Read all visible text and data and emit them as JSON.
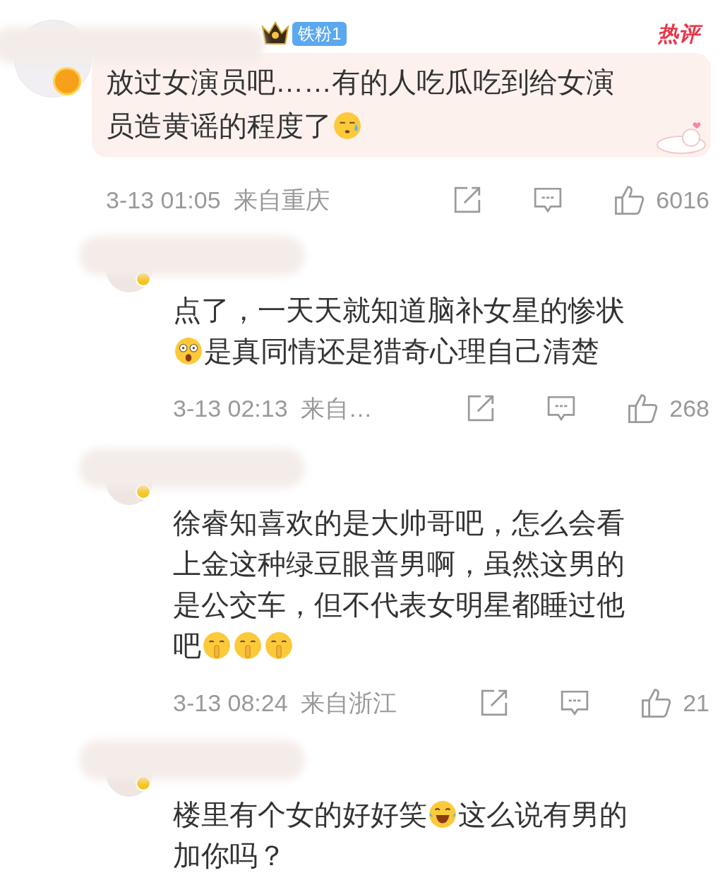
{
  "comments": [
    {
      "kind": "top",
      "hot_label": "热评",
      "fan_badge": "铁粉1",
      "lines": [
        [
          {
            "kind": "text",
            "text": "放过女演员吧……有的人吃瓜吃到给女演"
          }
        ],
        [
          {
            "kind": "text",
            "text": "员造黄谣的程度了"
          },
          {
            "kind": "sweat"
          }
        ]
      ],
      "time": "3-13 01:05",
      "location": "来自重庆",
      "likes": "6016"
    },
    {
      "kind": "reply",
      "lines": [
        [
          {
            "kind": "text",
            "text": "点了，一天天就知道脑补女星的惨状"
          }
        ],
        [
          {
            "kind": "shocked"
          },
          {
            "kind": "text",
            "text": "是真同情还是猎奇心理自己清楚"
          }
        ]
      ],
      "time": "3-13 02:13",
      "location": "来自…",
      "likes": "268"
    },
    {
      "kind": "reply",
      "lines": [
        [
          {
            "kind": "text",
            "text": "徐睿知喜欢的是大帅哥吧，怎么会看"
          }
        ],
        [
          {
            "kind": "text",
            "text": "上金这种绿豆眼普男啊，虽然这男的"
          }
        ],
        [
          {
            "kind": "text",
            "text": "是公交车，但不代表女明星都睡过他"
          }
        ],
        [
          {
            "kind": "text",
            "text": "吧"
          },
          {
            "kind": "shush"
          },
          {
            "kind": "shush"
          },
          {
            "kind": "shush"
          }
        ]
      ],
      "time": "3-13 08:24",
      "location": "来自浙江",
      "likes": "21"
    },
    {
      "kind": "reply",
      "lines": [
        [
          {
            "kind": "text",
            "text": "楼里有个女的好好笑"
          },
          {
            "kind": "laugh"
          },
          {
            "kind": "text",
            "text": "这么说有男的"
          }
        ],
        [
          {
            "kind": "text",
            "text": "加你吗？"
          }
        ]
      ]
    }
  ]
}
